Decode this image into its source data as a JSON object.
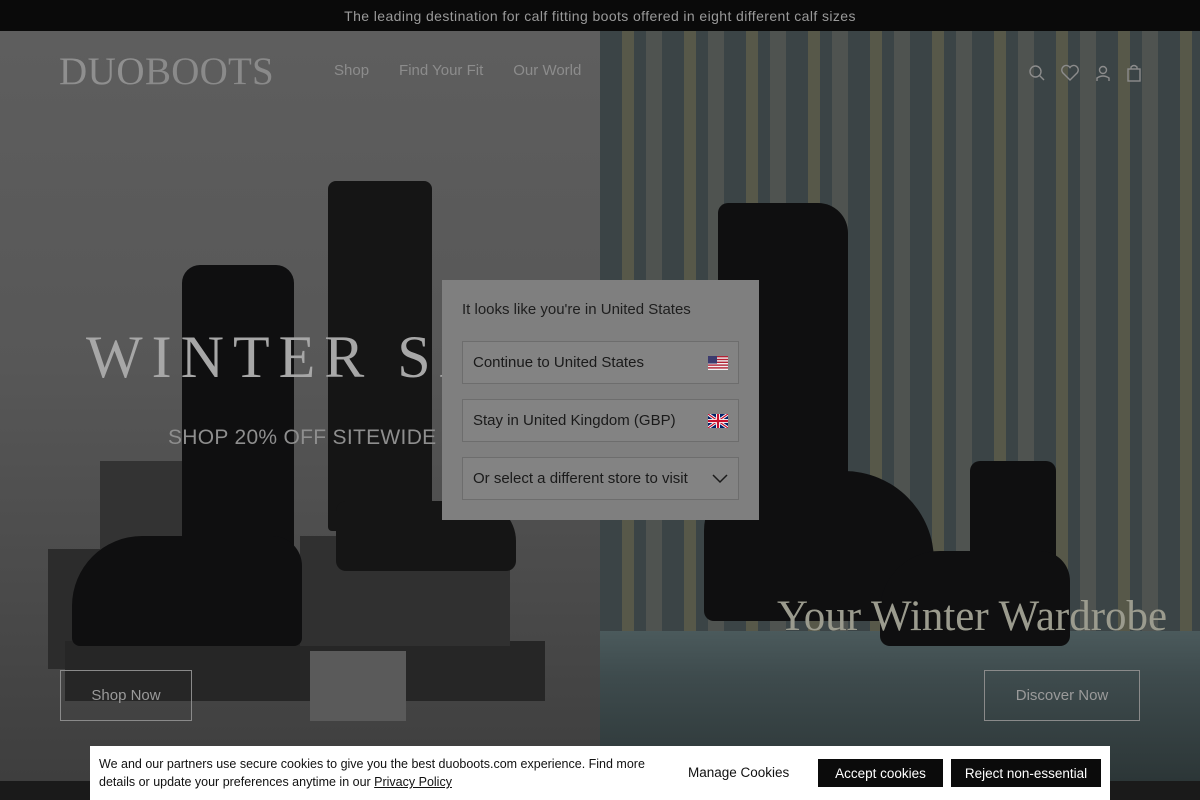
{
  "announcement": "The leading destination for calf fitting boots offered in eight different calf sizes",
  "header": {
    "logo_bold": "DUO",
    "logo_thin": "BOOTS",
    "menu": [
      "Shop",
      "Find Your Fit",
      "Our World"
    ],
    "icons": [
      "search-icon",
      "wishlist-heart-icon",
      "account-icon",
      "bag-icon"
    ]
  },
  "hero": {
    "left": {
      "headline": "WINTER SA",
      "subheadline": "SHOP 20% OFF SITEWIDE",
      "cta": "Shop Now"
    },
    "right": {
      "headline": "Your Winter Wardrobe",
      "cta": "Discover Now"
    }
  },
  "region_modal": {
    "title": "It looks like you're in United States",
    "options": [
      {
        "label": "Continue to United States",
        "icon": "us-flag-icon"
      },
      {
        "label": "Stay in United Kingdom (GBP)",
        "icon": "uk-flag-icon"
      },
      {
        "label": "Or select a different store to visit",
        "icon": "chevron-down-icon"
      }
    ]
  },
  "cookie_banner": {
    "text_before_link": "We and our partners use secure cookies to give you the best duoboots.com experience. Find more details or update your preferences anytime in our ",
    "link": "Privacy Policy",
    "manage": "Manage Cookies",
    "accept": "Accept cookies",
    "reject": "Reject non-essential"
  }
}
